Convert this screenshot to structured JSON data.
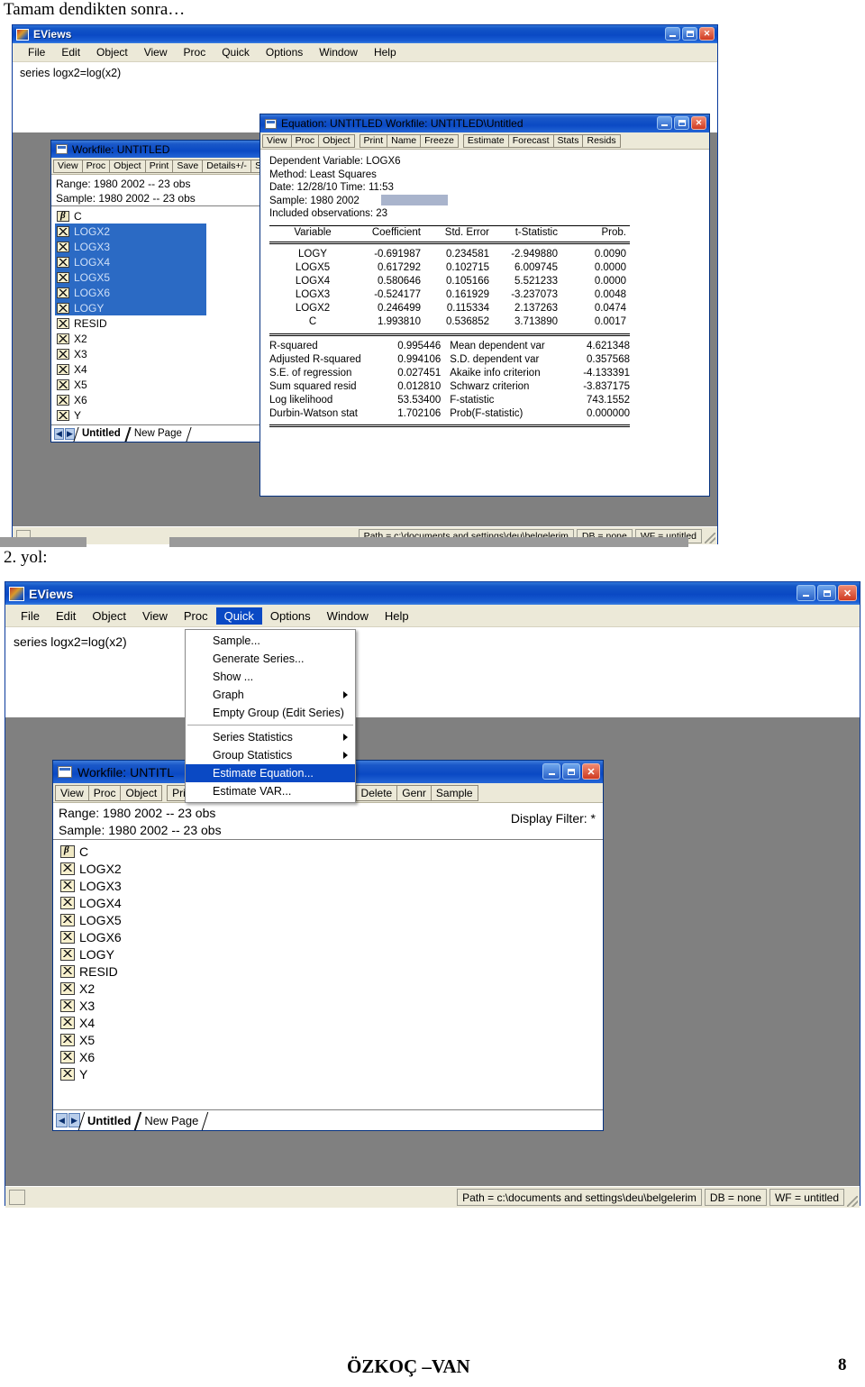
{
  "document": {
    "caption_top": "Tamam dendikten sonra…",
    "caption_mid": "2. yol:",
    "footer_author": "ÖZKOÇ –VAN",
    "footer_page": "8"
  },
  "app1": {
    "title": "EViews",
    "menu": [
      "File",
      "Edit",
      "Object",
      "View",
      "Proc",
      "Quick",
      "Options",
      "Window",
      "Help"
    ],
    "command": "series logx2=log(x2)",
    "status": {
      "path": "Path = c:\\documents and settings\\deu\\belgelerim",
      "db": "DB = none",
      "wf": "WF = untitled"
    },
    "workfile": {
      "title": "Workfile: UNTITLED",
      "toolbar": [
        "View",
        "Proc",
        "Object",
        "Print",
        "Save",
        "Details+/-",
        "Show"
      ],
      "range": "Range:   1980 2002   --   23 obs",
      "sample": "Sample: 1980 2002   --   23 obs",
      "series": [
        {
          "name": "C",
          "icon": "beta-icon",
          "selected": false
        },
        {
          "name": "LOGX2",
          "icon": "series-icon",
          "selected": true
        },
        {
          "name": "LOGX3",
          "icon": "series-icon",
          "selected": true
        },
        {
          "name": "LOGX4",
          "icon": "series-icon",
          "selected": true
        },
        {
          "name": "LOGX5",
          "icon": "series-icon",
          "selected": true
        },
        {
          "name": "LOGX6",
          "icon": "series-icon",
          "selected": true
        },
        {
          "name": "LOGY",
          "icon": "series-icon",
          "selected": true
        },
        {
          "name": "RESID",
          "icon": "series-icon",
          "selected": false
        },
        {
          "name": "X2",
          "icon": "series-icon",
          "selected": false
        },
        {
          "name": "X3",
          "icon": "series-icon",
          "selected": false
        },
        {
          "name": "X4",
          "icon": "series-icon",
          "selected": false
        },
        {
          "name": "X5",
          "icon": "series-icon",
          "selected": false
        },
        {
          "name": "X6",
          "icon": "series-icon",
          "selected": false
        },
        {
          "name": "Y",
          "icon": "series-icon",
          "selected": false
        }
      ],
      "tabs": [
        {
          "label": "Untitled",
          "active": true
        },
        {
          "label": "New Page",
          "active": false
        }
      ]
    },
    "equation": {
      "title": "Equation: UNTITLED   Workfile: UNTITLED\\Untitled",
      "toolbar": [
        "View",
        "Proc",
        "Object",
        "Print",
        "Name",
        "Freeze",
        "Estimate",
        "Forecast",
        "Stats",
        "Resids"
      ],
      "header": {
        "dependent": "Dependent Variable: LOGX6",
        "method": "Method: Least Squares",
        "date": "Date: 12/28/10   Time: 11:53",
        "sample": "Sample: 1980 2002",
        "observations": "Included observations: 23"
      },
      "table": {
        "columns": [
          "Variable",
          "Coefficient",
          "Std. Error",
          "t-Statistic",
          "Prob."
        ],
        "rows": [
          {
            "variable": "LOGY",
            "coefficient": "-0.691987",
            "std_error": "0.234581",
            "t_statistic": "-2.949880",
            "prob": "0.0090"
          },
          {
            "variable": "LOGX5",
            "coefficient": "0.617292",
            "std_error": "0.102715",
            "t_statistic": "6.009745",
            "prob": "0.0000"
          },
          {
            "variable": "LOGX4",
            "coefficient": "0.580646",
            "std_error": "0.105166",
            "t_statistic": "5.521233",
            "prob": "0.0000"
          },
          {
            "variable": "LOGX3",
            "coefficient": "-0.524177",
            "std_error": "0.161929",
            "t_statistic": "-3.237073",
            "prob": "0.0048"
          },
          {
            "variable": "LOGX2",
            "coefficient": "0.246499",
            "std_error": "0.115334",
            "t_statistic": "2.137263",
            "prob": "0.0474"
          },
          {
            "variable": "C",
            "coefficient": "1.993810",
            "std_error": "0.536852",
            "t_statistic": "3.713890",
            "prob": "0.0017"
          }
        ]
      },
      "stats": [
        {
          "l1": "R-squared",
          "v1": "0.995446",
          "l2": "Mean dependent var",
          "v2": "4.621348"
        },
        {
          "l1": "Adjusted R-squared",
          "v1": "0.994106",
          "l2": "S.D. dependent var",
          "v2": "0.357568"
        },
        {
          "l1": "S.E. of regression",
          "v1": "0.027451",
          "l2": "Akaike info criterion",
          "v2": "-4.133391"
        },
        {
          "l1": "Sum squared resid",
          "v1": "0.012810",
          "l2": "Schwarz criterion",
          "v2": "-3.837175"
        },
        {
          "l1": "Log likelihood",
          "v1": "53.53400",
          "l2": "F-statistic",
          "v2": "743.1552"
        },
        {
          "l1": "Durbin-Watson stat",
          "v1": "1.702106",
          "l2": "Prob(F-statistic)",
          "v2": "0.000000"
        }
      ]
    }
  },
  "app2": {
    "title": "EViews",
    "menu": [
      "File",
      "Edit",
      "Object",
      "View",
      "Proc",
      "Quick",
      "Options",
      "Window",
      "Help"
    ],
    "active_menu": "Quick",
    "command": "series logx2=log(x2)",
    "status": {
      "path": "Path = c:\\documents and settings\\deu\\belgelerim",
      "db": "DB = none",
      "wf": "WF = untitled"
    },
    "quick_menu": [
      {
        "label": "Sample...",
        "submenu": false,
        "selected": false
      },
      {
        "label": "Generate Series...",
        "submenu": false,
        "selected": false
      },
      {
        "label": "Show ...",
        "submenu": false,
        "selected": false
      },
      {
        "label": "Graph",
        "submenu": true,
        "selected": false
      },
      {
        "label": "Empty Group (Edit Series)",
        "submenu": false,
        "selected": false
      },
      {
        "separator": true
      },
      {
        "label": "Series Statistics",
        "submenu": true,
        "selected": false
      },
      {
        "label": "Group Statistics",
        "submenu": true,
        "selected": false
      },
      {
        "label": "Estimate Equation...",
        "submenu": false,
        "selected": true
      },
      {
        "label": "Estimate VAR...",
        "submenu": false,
        "selected": false
      }
    ],
    "workfile": {
      "title": "Workfile: UNTITL",
      "toolbar_left": [
        "View",
        "Proc",
        "Object",
        "Print"
      ],
      "toolbar_right": [
        "tore",
        "Delete",
        "Genr",
        "Sample"
      ],
      "range": "Range:  1980 2002   --   23 obs",
      "sample": "Sample: 1980 2002   --   23 obs",
      "display_filter": "Display Filter: *",
      "series": [
        {
          "name": "C",
          "icon": "beta-icon"
        },
        {
          "name": "LOGX2",
          "icon": "series-icon"
        },
        {
          "name": "LOGX3",
          "icon": "series-icon"
        },
        {
          "name": "LOGX4",
          "icon": "series-icon"
        },
        {
          "name": "LOGX5",
          "icon": "series-icon"
        },
        {
          "name": "LOGX6",
          "icon": "series-icon"
        },
        {
          "name": "LOGY",
          "icon": "series-icon"
        },
        {
          "name": "RESID",
          "icon": "series-icon"
        },
        {
          "name": "X2",
          "icon": "series-icon"
        },
        {
          "name": "X3",
          "icon": "series-icon"
        },
        {
          "name": "X4",
          "icon": "series-icon"
        },
        {
          "name": "X5",
          "icon": "series-icon"
        },
        {
          "name": "X6",
          "icon": "series-icon"
        },
        {
          "name": "Y",
          "icon": "series-icon"
        }
      ],
      "tabs": [
        {
          "label": "Untitled",
          "active": true
        },
        {
          "label": "New Page",
          "active": false
        }
      ]
    }
  }
}
